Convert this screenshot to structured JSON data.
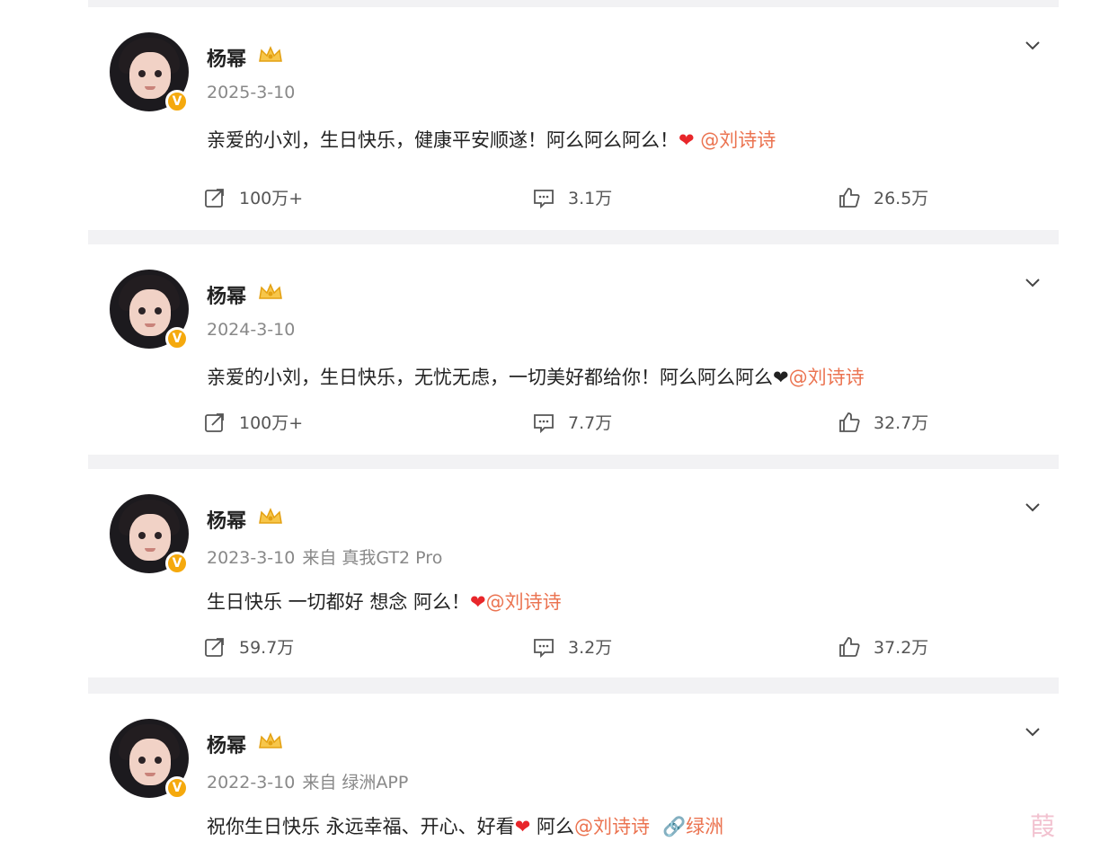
{
  "posts": [
    {
      "user": "杨幂",
      "date": "2025-3-10",
      "source_prefix": "",
      "source": "",
      "text": "亲爱的小刘，生日快乐，健康平安顺遂！阿么阿么阿么！",
      "heart": "❤",
      "mention": "@刘诗诗",
      "reposts": "100万+",
      "comments": "3.1万",
      "likes": "26.5万"
    },
    {
      "user": "杨幂",
      "date": "2024-3-10",
      "source_prefix": "",
      "source": "",
      "text": "亲爱的小刘，生日快乐，无忧无虑，一切美好都给你！阿么阿么阿么",
      "heart": "❤",
      "mention": "@刘诗诗",
      "reposts": "100万+",
      "comments": "7.7万",
      "likes": "32.7万"
    },
    {
      "user": "杨幂",
      "date": "2023-3-10",
      "source_prefix": "来自",
      "source": "真我GT2 Pro",
      "text": "生日快乐 一切都好 想念 阿么！",
      "heart": "❤",
      "mention": "@刘诗诗",
      "reposts": "59.7万",
      "comments": "3.2万",
      "likes": "37.2万"
    },
    {
      "user": "杨幂",
      "date": "2022-3-10",
      "source_prefix": "来自",
      "source": "绿洲APP",
      "text": "祝你生日快乐 永远幸福、开心、好看",
      "heart": "❤",
      "text_after_heart": " 阿么",
      "mention": "@刘诗诗",
      "link_label": "绿洲"
    }
  ],
  "watermark": "葭",
  "colors": {
    "mention": "#eb7350",
    "heart_red": "#e8262a",
    "verified_badge": "#f5a90d",
    "page_bg": "#f2f2f4"
  }
}
